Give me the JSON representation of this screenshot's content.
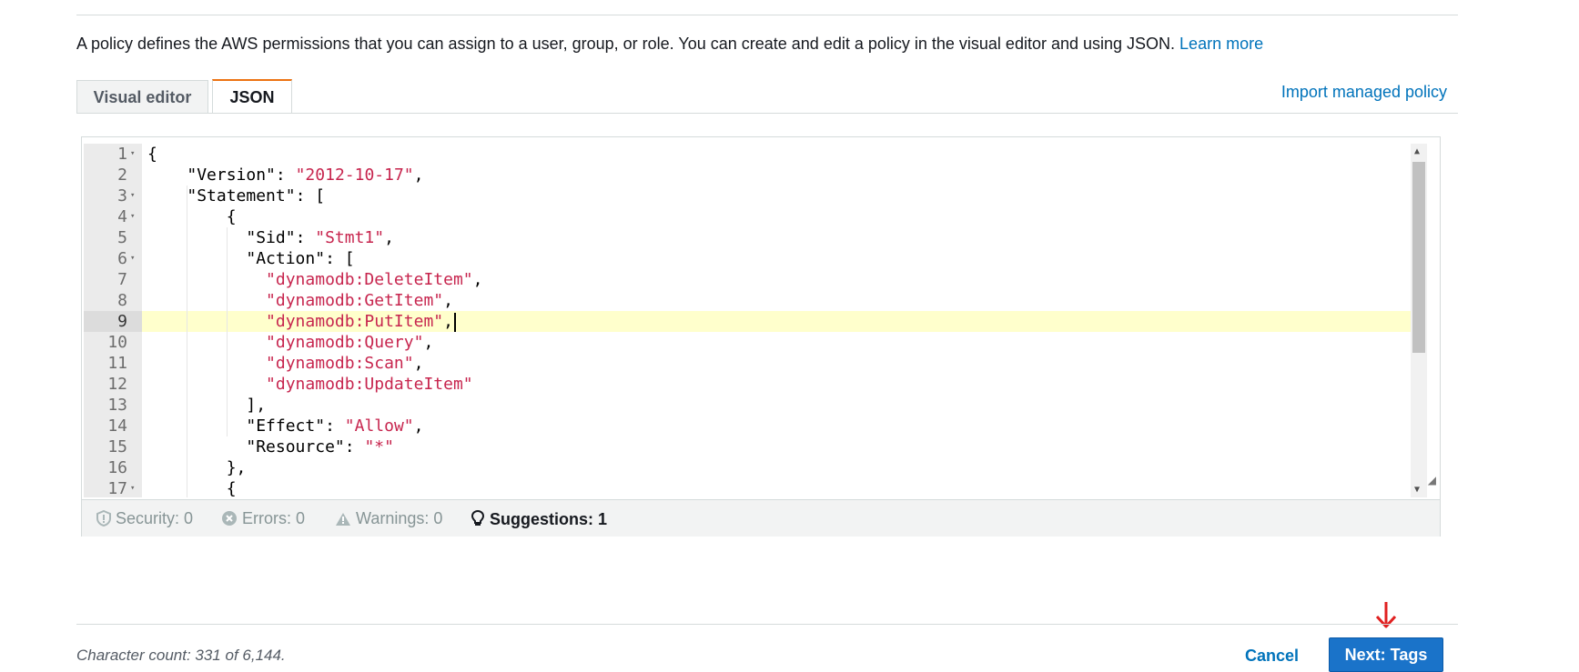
{
  "description": {
    "text": "A policy defines the AWS permissions that you can assign to a user, group, or role. You can create and edit a policy in the visual editor and using JSON.",
    "link": "Learn more"
  },
  "tabs": [
    {
      "label": "Visual editor",
      "active": false
    },
    {
      "label": "JSON",
      "active": true
    }
  ],
  "import_link": "Import managed policy",
  "editor": {
    "active_line": 9,
    "lines": [
      {
        "n": "1",
        "fold": true
      },
      {
        "n": "2",
        "fold": false
      },
      {
        "n": "3",
        "fold": true
      },
      {
        "n": "4",
        "fold": true
      },
      {
        "n": "5",
        "fold": false
      },
      {
        "n": "6",
        "fold": true
      },
      {
        "n": "7",
        "fold": false
      },
      {
        "n": "8",
        "fold": false
      },
      {
        "n": "9",
        "fold": false
      },
      {
        "n": "10",
        "fold": false
      },
      {
        "n": "11",
        "fold": false
      },
      {
        "n": "12",
        "fold": false
      },
      {
        "n": "13",
        "fold": false
      },
      {
        "n": "14",
        "fold": false
      },
      {
        "n": "15",
        "fold": false
      },
      {
        "n": "16",
        "fold": false
      },
      {
        "n": "17",
        "fold": true
      }
    ],
    "code": {
      "l1": "{",
      "l2_key": "\"Version\"",
      "l2_sep": ": ",
      "l2_val": "\"2012-10-17\"",
      "l2_end": ",",
      "l3_key": "\"Statement\"",
      "l3_end": ": [",
      "l4": "{",
      "l5_key": "\"Sid\"",
      "l5_sep": ": ",
      "l5_val": "\"Stmt1\"",
      "l5_end": ",",
      "l6_key": "\"Action\"",
      "l6_end": ": [",
      "l7_val": "\"dynamodb:DeleteItem\"",
      "l7_end": ",",
      "l8_val": "\"dynamodb:GetItem\"",
      "l8_end": ",",
      "l9_val": "\"dynamodb:PutItem\"",
      "l9_end": ",",
      "l10_val": "\"dynamodb:Query\"",
      "l10_end": ",",
      "l11_val": "\"dynamodb:Scan\"",
      "l11_end": ",",
      "l12_val": "\"dynamodb:UpdateItem\"",
      "l13": "],",
      "l14_key": "\"Effect\"",
      "l14_sep": ": ",
      "l14_val": "\"Allow\"",
      "l14_end": ",",
      "l15_key": "\"Resource\"",
      "l15_sep": ": ",
      "l15_val": "\"*\"",
      "l16": "},",
      "l17": "{"
    }
  },
  "status": {
    "security": "Security: 0",
    "errors": "Errors: 0",
    "warnings": "Warnings: 0",
    "suggestions": "Suggestions: 1"
  },
  "footer": {
    "char_count": "Character count: 331 of 6,144.",
    "cancel": "Cancel",
    "next": "Next: Tags"
  },
  "colors": {
    "link": "#0073bb",
    "primary_button": "#1a73c9",
    "active_tab_accent": "#ec7211",
    "string_token": "#c7254e",
    "annotation_arrow": "#e02020"
  }
}
